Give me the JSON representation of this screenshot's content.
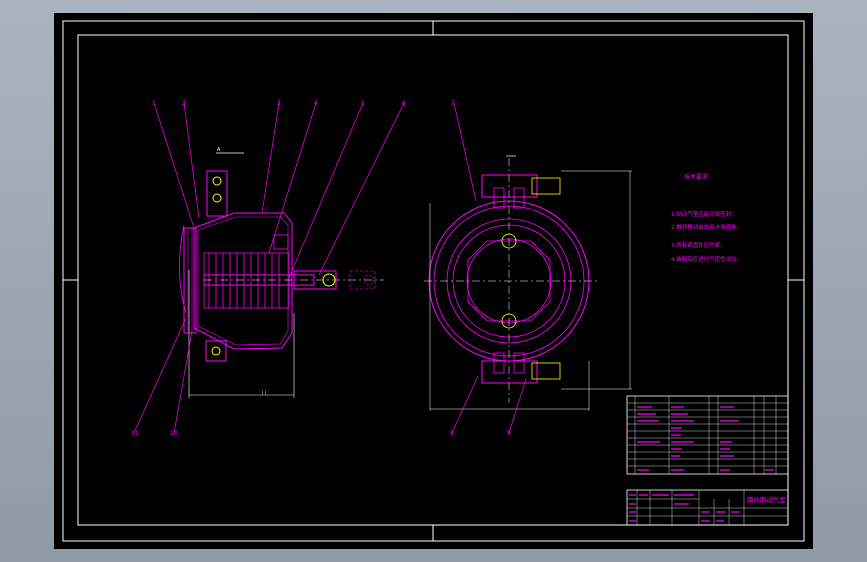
{
  "balloons": [
    "1",
    "2",
    "3",
    "4",
    "5",
    "6",
    "7",
    "8",
    "9",
    "10",
    "11"
  ],
  "tech_requirements_title": "技术要求",
  "tech_requirements": [
    "1.制动气室应能可靠密封。",
    "2.推杆移动自如无卡滞现象。",
    "3.所有紧固件应拧紧。",
    "4.装配后应进行气密性试验。"
  ],
  "title_block": {
    "drawing_name": "膜片制动气室"
  },
  "colors": {
    "background": "#000000",
    "frame": "#ffffff",
    "drawing": "#ff00ff",
    "accent": "#ffff00"
  }
}
